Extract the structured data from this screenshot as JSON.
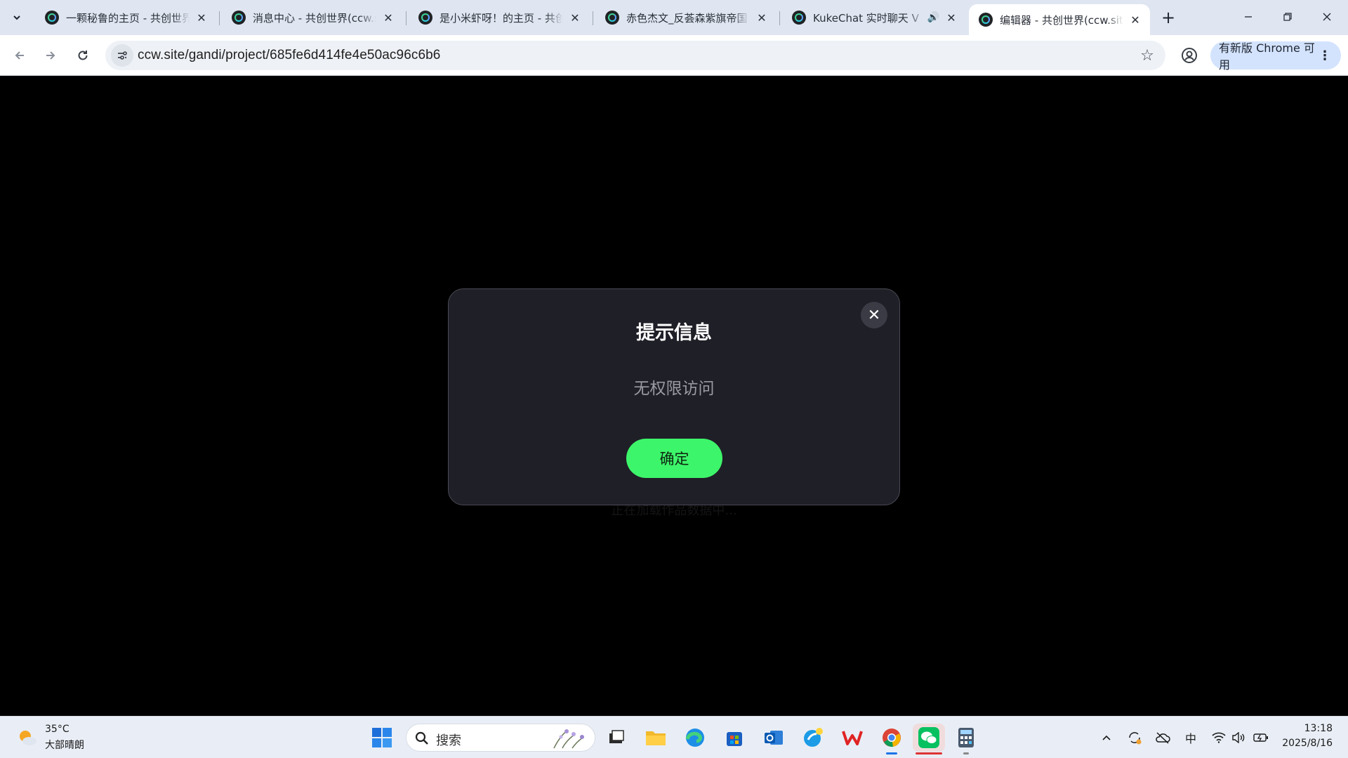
{
  "browser": {
    "tabs": [
      {
        "title": "一颗秘鲁的主页 - 共创世界",
        "active": false,
        "audio": false
      },
      {
        "title": "消息中心 - 共创世界(ccw.site)",
        "active": false,
        "audio": false
      },
      {
        "title": "是小米虾呀！的主页 - 共创世界",
        "active": false,
        "audio": false
      },
      {
        "title": "赤色杰文_反荟森紫旗帝国",
        "active": false,
        "audio": false
      },
      {
        "title": "KukeChat 实时聊天 V",
        "active": false,
        "audio": true
      },
      {
        "title": "编辑器 - 共创世界(ccw.site)",
        "active": true,
        "audio": false
      }
    ],
    "url": "ccw.site/gandi/project/685fe6d414fe4e50ac96c6b6",
    "update_label": "有新版 Chrome 可用"
  },
  "page": {
    "loading_text": "正在加载作品数据中..."
  },
  "dialog": {
    "title": "提示信息",
    "message": "无权限访问",
    "ok_label": "确定",
    "close_symbol": "✕"
  },
  "taskbar": {
    "weather_temp": "35°C",
    "weather_desc": "大部晴朗",
    "search_label": "搜索",
    "ime": "中",
    "time": "13:18",
    "date": "2025/8/16"
  },
  "colors": {
    "dialog_bg": "#1f1f27",
    "ok_button": "#3df56a",
    "page_bg": "#000000"
  }
}
